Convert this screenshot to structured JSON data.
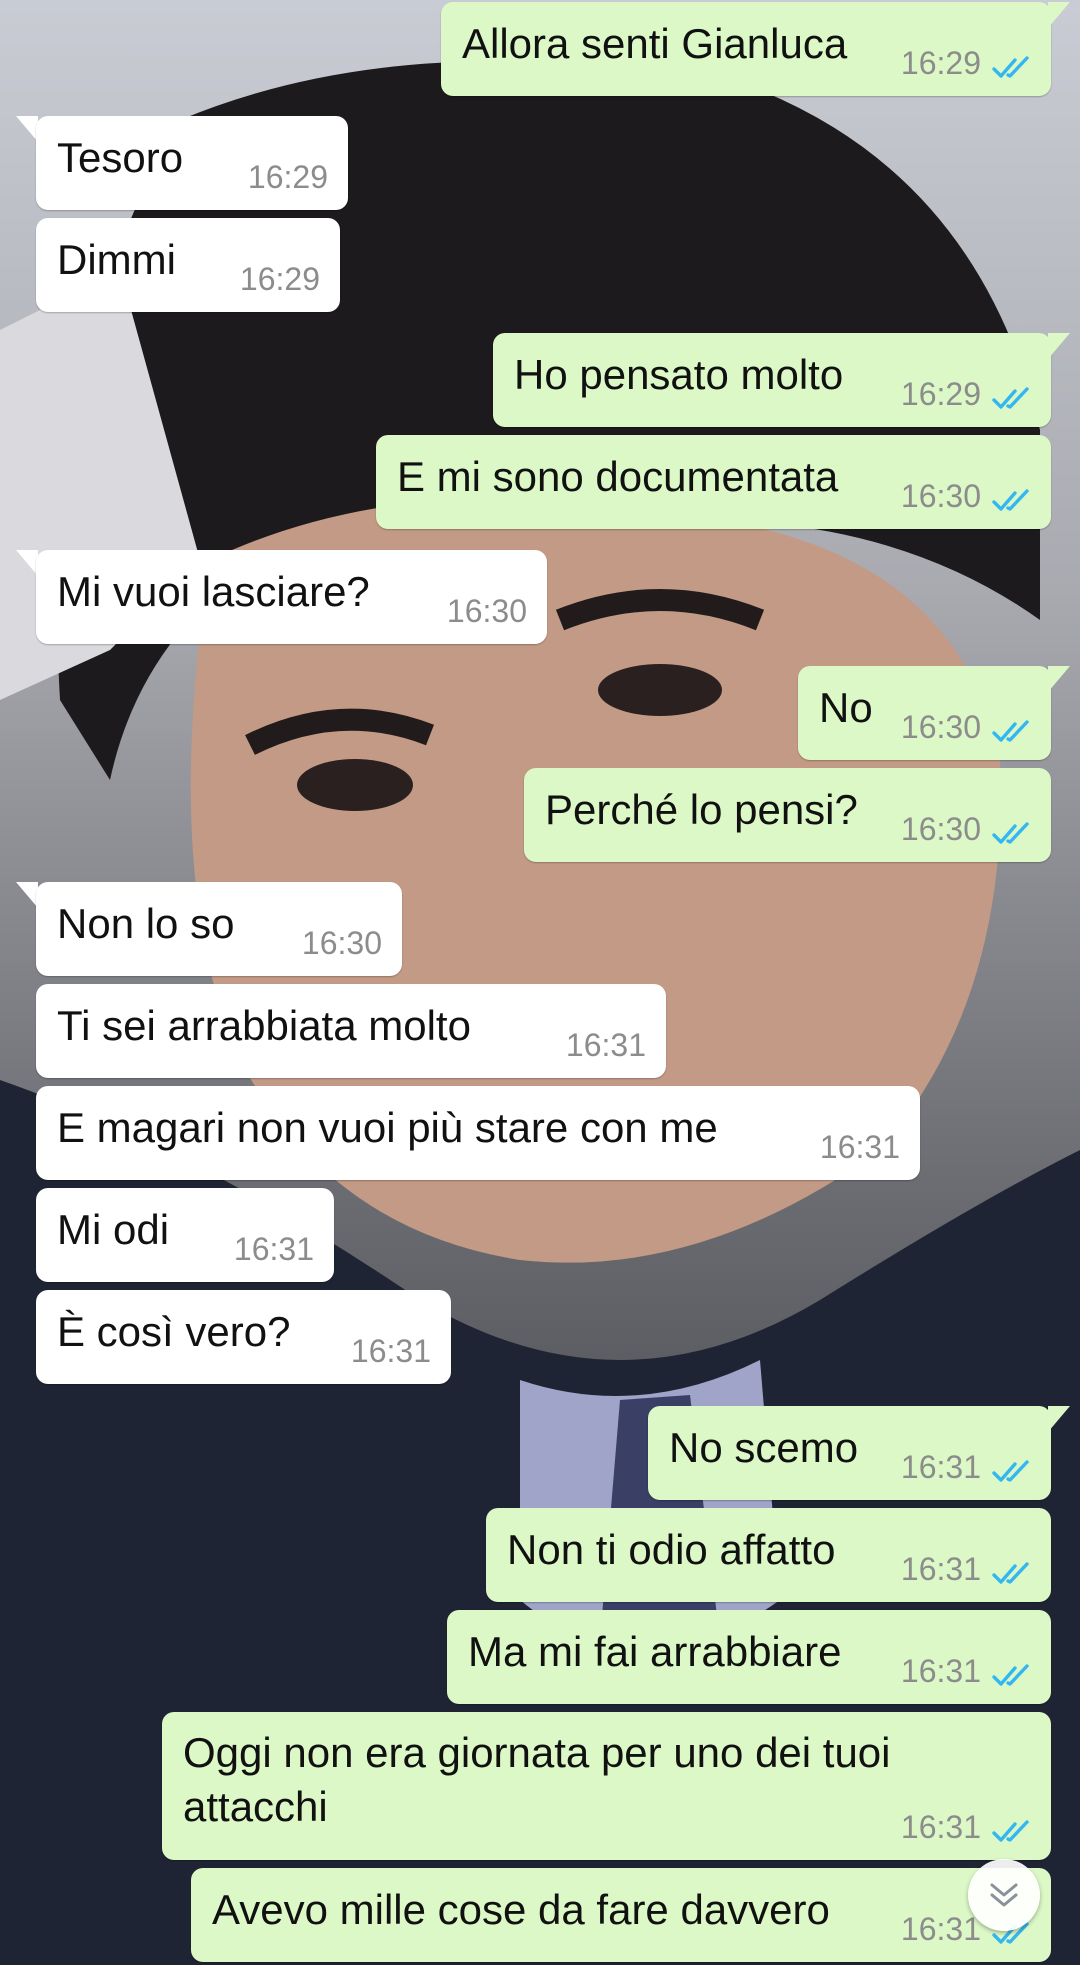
{
  "messages": [
    {
      "side": "out",
      "text": "Allora senti Gianluca",
      "time": "16:29"
    },
    {
      "side": "in",
      "text": "Tesoro",
      "time": "16:29"
    },
    {
      "side": "in",
      "text": "Dimmi",
      "time": "16:29"
    },
    {
      "side": "out",
      "text": "Ho pensato molto",
      "time": "16:29"
    },
    {
      "side": "out",
      "text": "E mi sono documentata",
      "time": "16:30"
    },
    {
      "side": "in",
      "text": "Mi vuoi lasciare?",
      "time": "16:30"
    },
    {
      "side": "out",
      "text": "No",
      "time": "16:30"
    },
    {
      "side": "out",
      "text": "Perché lo pensi?",
      "time": "16:30"
    },
    {
      "side": "in",
      "text": "Non lo so",
      "time": "16:30"
    },
    {
      "side": "in",
      "text": "Ti sei arrabbiata molto",
      "time": "16:31"
    },
    {
      "side": "in",
      "text": "E magari non vuoi più stare con me",
      "time": "16:31"
    },
    {
      "side": "in",
      "text": "Mi odi",
      "time": "16:31"
    },
    {
      "side": "in",
      "text": "È così vero?",
      "time": "16:31"
    },
    {
      "side": "out",
      "text": "No scemo",
      "time": "16:31"
    },
    {
      "side": "out",
      "text": "Non ti odio affatto",
      "time": "16:31"
    },
    {
      "side": "out",
      "text": "Ma mi fai arrabbiare",
      "time": "16:31"
    },
    {
      "side": "out",
      "text": "Oggi non era giornata per uno dei tuoi attacchi",
      "time": "16:31"
    },
    {
      "side": "out",
      "text": "Avevo mille cose da fare davvero",
      "time": "16:31"
    }
  ],
  "colors": {
    "incoming_bubble": "#ffffff",
    "outgoing_bubble": "#dcf8c6",
    "read_ticks": "#34b7f1",
    "time_text": "#8c8c8c"
  },
  "icons": {
    "read_receipt": "double-check-icon",
    "scroll": "chevron-down-icon"
  }
}
